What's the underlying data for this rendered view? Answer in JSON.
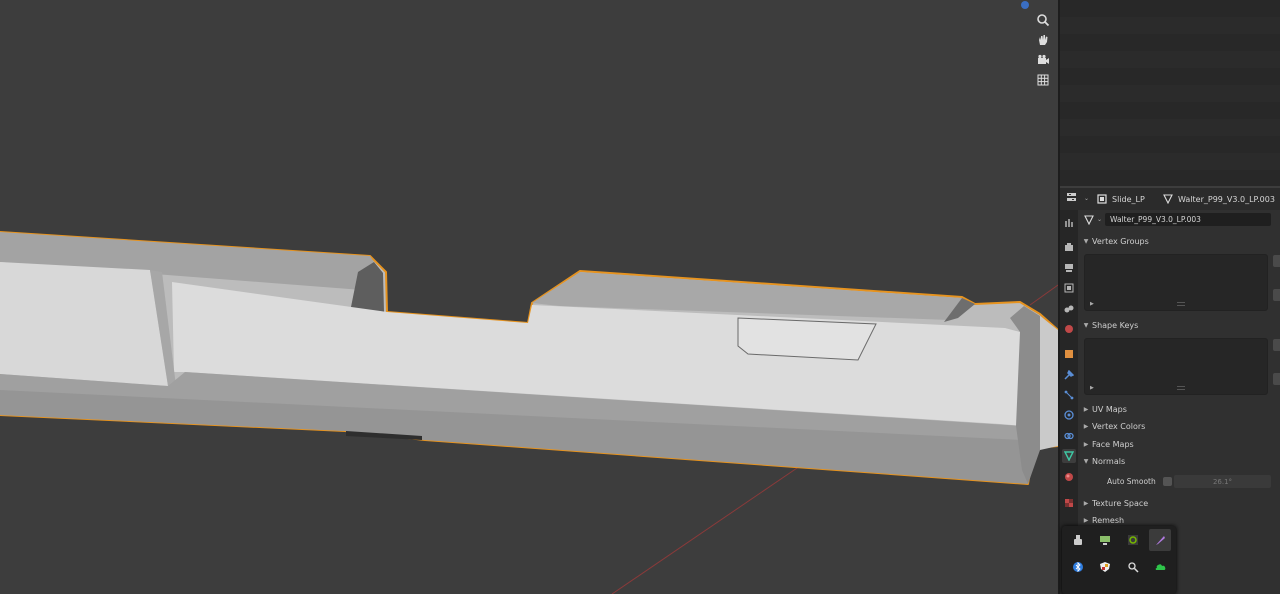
{
  "viewport": {
    "background": "#3d3d3d",
    "selection_outline_color": "#e6931f",
    "mesh_light": "#d6d6d6",
    "mesh_mid": "#bcbcbc",
    "mesh_dark": "#9a9a9a",
    "nav_icons": [
      "zoom-icon",
      "hand-pan-icon",
      "camera-icon",
      "grid-icon"
    ]
  },
  "properties": {
    "header": {
      "object_name": "Slide_LP",
      "mesh_name": "Walter_P99_V3.0_LP.003"
    },
    "mesh_datablock": "Walter_P99_V3.0_LP.003",
    "panels": {
      "vertex_groups": "Vertex Groups",
      "shape_keys": "Shape Keys",
      "uv_maps": "UV Maps",
      "vertex_colors": "Vertex Colors",
      "face_maps": "Face Maps",
      "normals": "Normals",
      "texture_space": "Texture Space",
      "remesh": "Remesh"
    },
    "normals": {
      "auto_smooth_label": "Auto Smooth",
      "auto_smooth_checked": false,
      "angle": "26.1°"
    },
    "tabs": [
      "tool-icon",
      "render-icon",
      "output-icon",
      "view-layer-icon",
      "scene-icon",
      "world-icon",
      "object-icon",
      "modifier-icon",
      "particles-icon",
      "physics-icon",
      "constraints-icon",
      "mesh-data-icon",
      "material-icon",
      "texture-icon"
    ],
    "active_tab": "mesh-data-icon"
  },
  "tray": {
    "icons": [
      "usb-icon",
      "display-icon",
      "nvidia-icon",
      "feather-icon",
      "bluetooth-icon",
      "shield-icon",
      "search-app-icon",
      "cloud-icon"
    ],
    "highlighted": "feather-icon"
  }
}
